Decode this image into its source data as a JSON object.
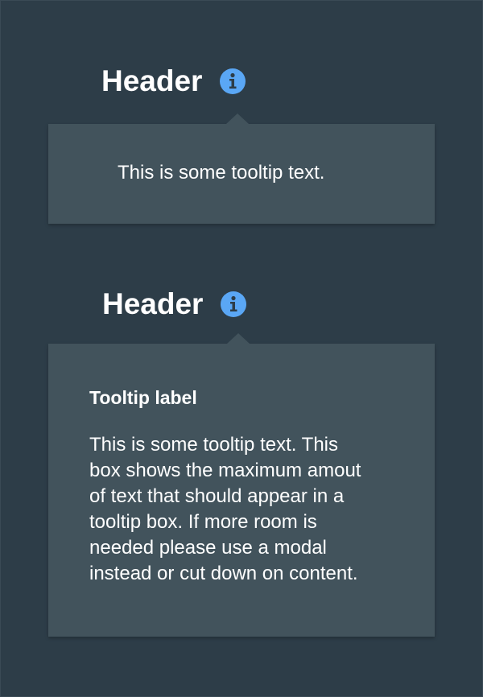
{
  "colors": {
    "background": "#2d3d48",
    "tooltip_bg": "#42535c",
    "icon_accent": "#5aa7f5",
    "text": "#ffffff"
  },
  "sections": [
    {
      "header": "Header",
      "icon": "info-icon",
      "tooltip_text": "This is some tooltip text."
    },
    {
      "header": "Header",
      "icon": "info-icon",
      "tooltip_label": "Tooltip label",
      "tooltip_text": "This is some tooltip text. This\nbox shows the maximum amout\nof text that should appear in a\ntooltip box. If more room is\nneeded please use a modal\ninstead or cut down on content."
    }
  ]
}
